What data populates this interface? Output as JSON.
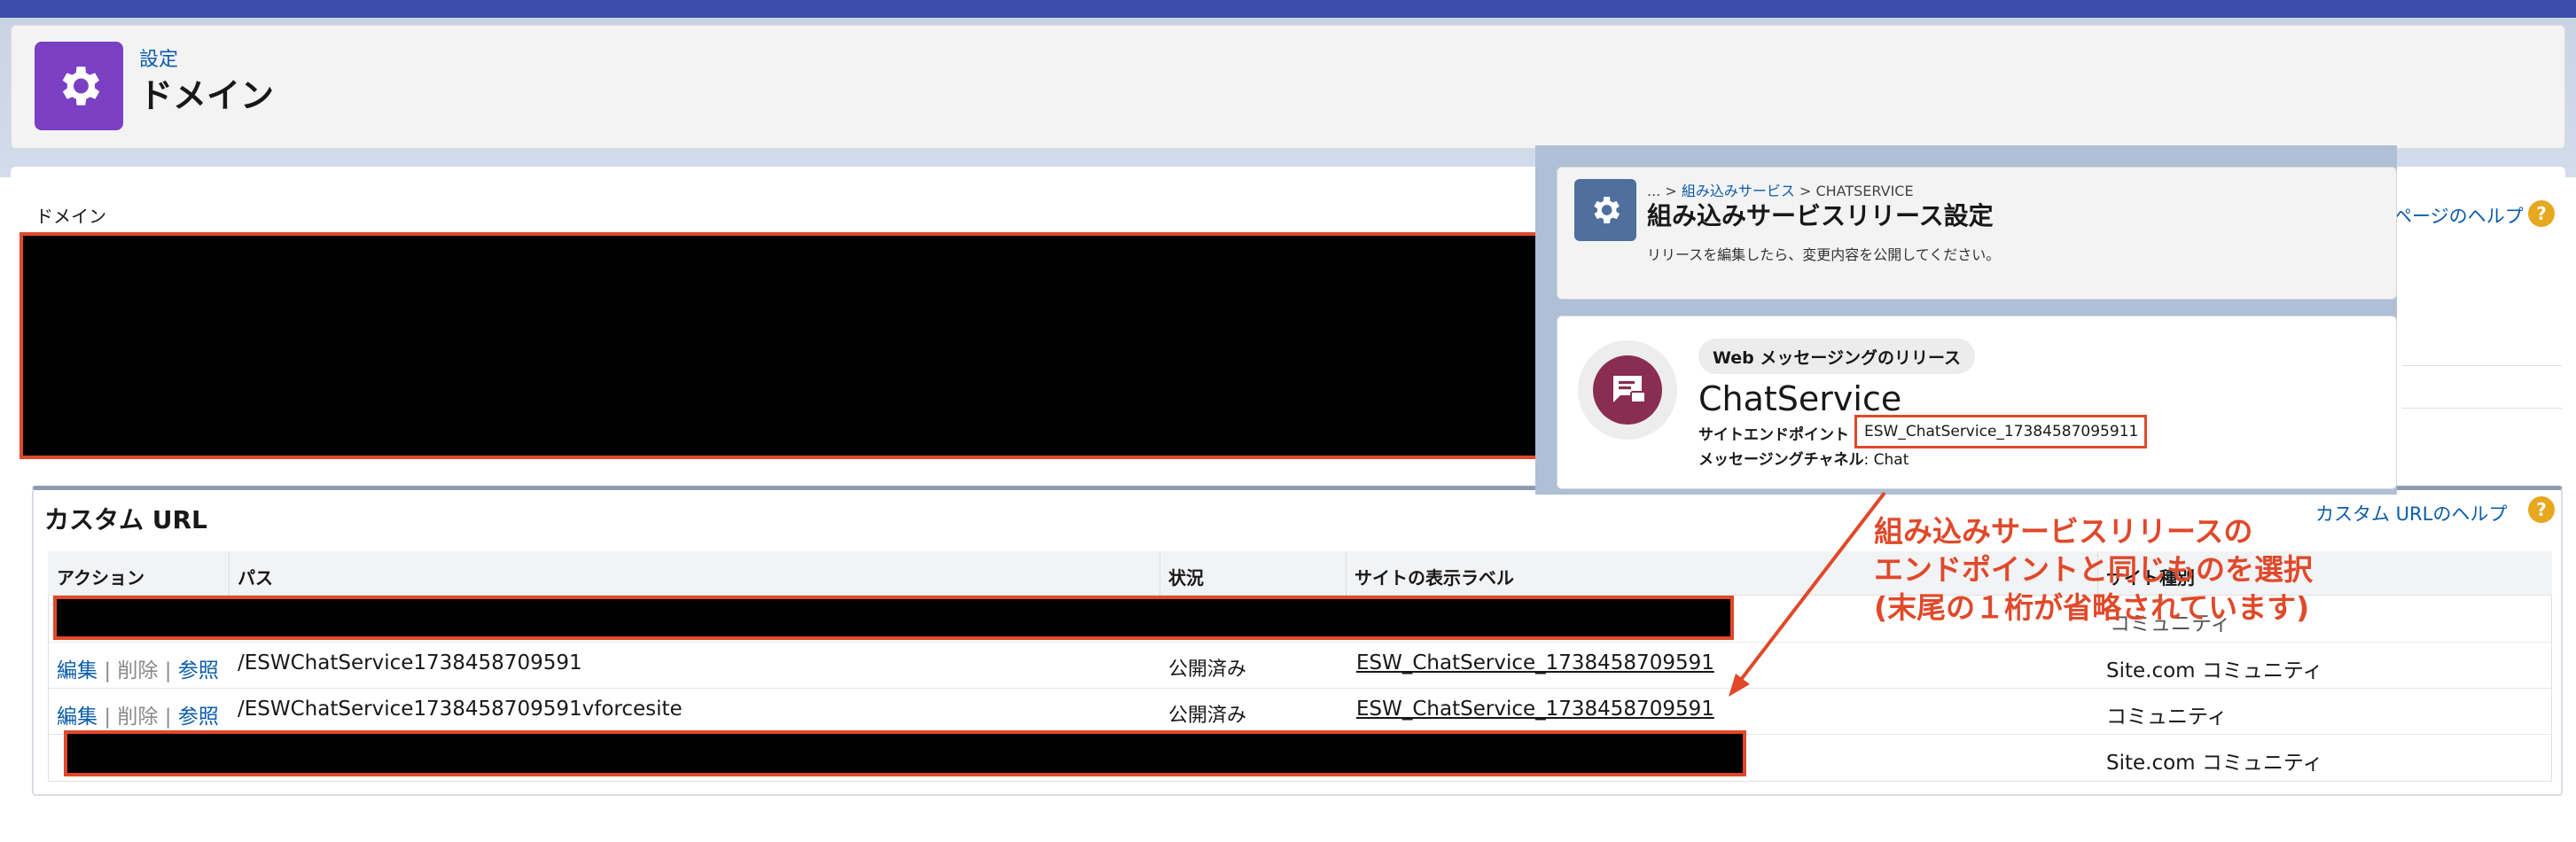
{
  "header": {
    "breadcrumb": "設定",
    "title": "ドメイン",
    "icon": "gear-icon"
  },
  "domain_section": {
    "label": "ドメイン"
  },
  "custom_url": {
    "title": "カスタム URL",
    "help_label": "カスタム URLのヘルプ",
    "columns": [
      "アクション",
      "パス",
      "状況",
      "サイトの表示ラベル",
      "サイト種別"
    ],
    "rows": [
      {
        "actions": [
          "編集",
          "削除",
          "参照"
        ],
        "path": "/ESWChatService1738458709591",
        "status": "公開済み",
        "site_label": "ESW_ChatService_1738458709591",
        "site_type": "Site.com コミュニティ"
      },
      {
        "actions": [
          "編集",
          "削除",
          "参照"
        ],
        "path": "/ESWChatService1738458709591vforcesite",
        "status": "公開済み",
        "site_label": "ESW_ChatService_1738458709591",
        "site_type": "コミュニティ"
      }
    ],
    "redacted_row_partial": "コミュニティ",
    "last_row_site_type": "Site.com コミュニティ",
    "separator": "|"
  },
  "page_help": {
    "label": "ページのヘルプ",
    "icon": "?"
  },
  "overlay": {
    "breadcrumb_prefix": "... > ",
    "breadcrumb_link": "組み込みサービス",
    "breadcrumb_suffix": " > CHATSERVICE",
    "title": "組み込みサービスリリース設定",
    "description": "リリースを編集したら、変更内容を公開してください。",
    "pill": "Web メッセージングのリリース",
    "name": "ChatService",
    "endpoint_label": "サイトエンドポイント",
    "endpoint_value": "ESW_ChatService_17384587095911",
    "channel_label": "メッセージングチャネル",
    "channel_value": "Chat"
  },
  "annotation": {
    "lines": [
      "組み込みサービスリリースの",
      "エンドポイントと同じものを選択",
      "(末尾の１桁が省略されています)"
    ],
    "color": "#e0492a"
  },
  "colors": {
    "accent_purple": "#7b3fc4",
    "link_blue": "#0b5cab",
    "highlight_red": "#e0492a"
  }
}
